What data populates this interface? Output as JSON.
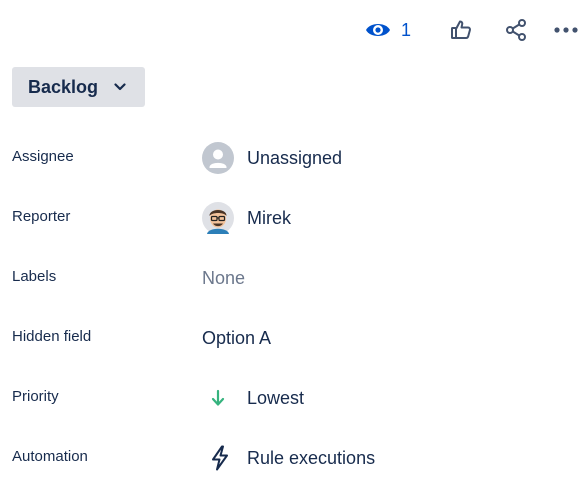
{
  "toolbar": {
    "watch_count": "1",
    "watch_icon": "eye-icon",
    "like_icon": "thumbs-up-icon",
    "share_icon": "share-icon",
    "more_icon": "more-horizontal-icon",
    "accent": "#0052cc"
  },
  "status": {
    "label": "Backlog",
    "icon": "chevron-down-icon",
    "background": "#dfe1e6"
  },
  "fields": {
    "assignee": {
      "label": "Assignee",
      "value": "Unassigned",
      "icon": "default-avatar-icon"
    },
    "reporter": {
      "label": "Reporter",
      "value": "Mirek",
      "icon": "user-avatar"
    },
    "labels": {
      "label": "Labels",
      "value": "None"
    },
    "hidden_field": {
      "label": "Hidden field",
      "value": "Option A"
    },
    "priority": {
      "label": "Priority",
      "value": "Lowest",
      "icon": "arrow-down-icon",
      "color": "#36b37e"
    },
    "automation": {
      "label": "Automation",
      "value": "Rule executions",
      "icon": "lightning-bolt-icon"
    }
  }
}
